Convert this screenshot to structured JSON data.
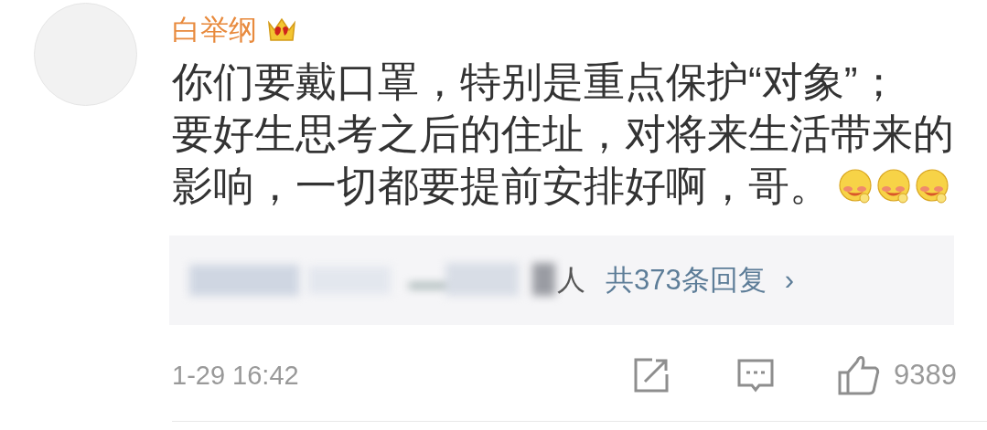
{
  "comment": {
    "author": "白举纲",
    "lines": [
      "你们要戴口罩，特别是重点保护“对象”；",
      "要好生思考之后的住址，对将来生活带来的",
      "影响，一切都要提前安排好啊，哥。"
    ],
    "emojis": [
      {
        "kind": "emoji"
      },
      {
        "kind": "emoji"
      },
      {
        "kind": "emoji"
      }
    ]
  },
  "replies": {
    "names": "人",
    "count": "共373条回复",
    "arrow": "›"
  },
  "footer": {
    "time": "1-29 16:42",
    "likes": "9389"
  }
}
